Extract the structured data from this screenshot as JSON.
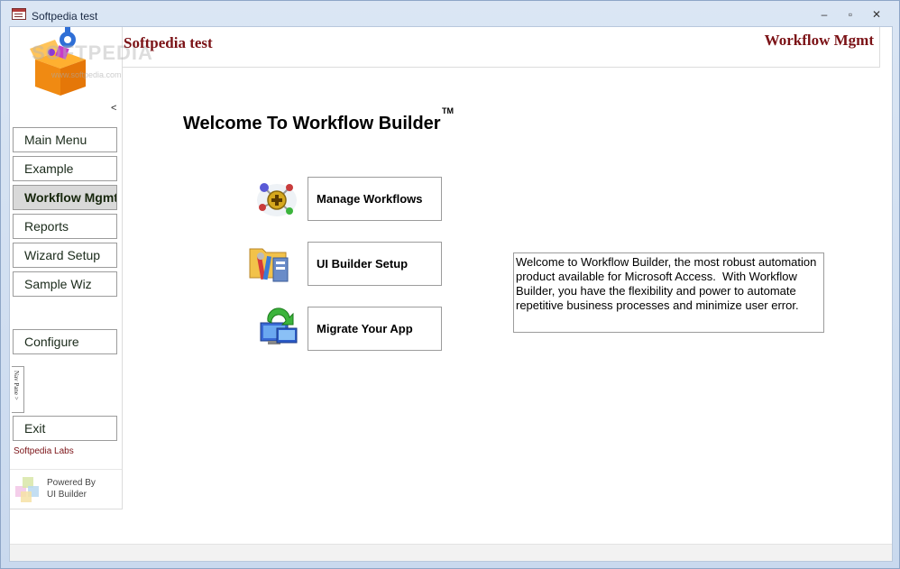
{
  "window": {
    "title": "Softpedia test",
    "minimize": "–",
    "maximize": "▫",
    "close": "✕"
  },
  "header": {
    "title": "Softpedia test",
    "right_title": "Workflow Mgmt"
  },
  "watermark": {
    "main": "SOFTPEDIA",
    "sub": "www.softpedia.com"
  },
  "nav": {
    "collapse": "<",
    "items": [
      {
        "label": "Main Menu"
      },
      {
        "label": "Example"
      },
      {
        "label": "Workflow Mgmt",
        "active": true
      },
      {
        "label": "Reports"
      },
      {
        "label": "Wizard Setup"
      },
      {
        "label": "Sample Wiz"
      },
      {
        "label": "Configure"
      },
      {
        "label": "Exit"
      }
    ],
    "nav_pane_tab": "Nav Pane >",
    "labs": "Softpedia Labs",
    "powered_line1": "Powered By",
    "powered_line2": "UI Builder"
  },
  "main": {
    "welcome": "Welcome To Workflow Builder",
    "tm": "TM",
    "actions": [
      {
        "label": "Manage Workflows",
        "icon": "workflow-molecule-icon"
      },
      {
        "label": "UI Builder Setup",
        "icon": "folder-tools-icon"
      },
      {
        "label": "Migrate Your App",
        "icon": "migrate-computer-icon"
      }
    ],
    "description": "Welcome to Workflow Builder, the most robust automation product available for Microsoft Access.  With Workflow Builder, you have the flexibility and power to automate repetitive business processes and minimize user error."
  },
  "colors": {
    "accent": "#7b1216",
    "frame": "#c9d9ee"
  }
}
